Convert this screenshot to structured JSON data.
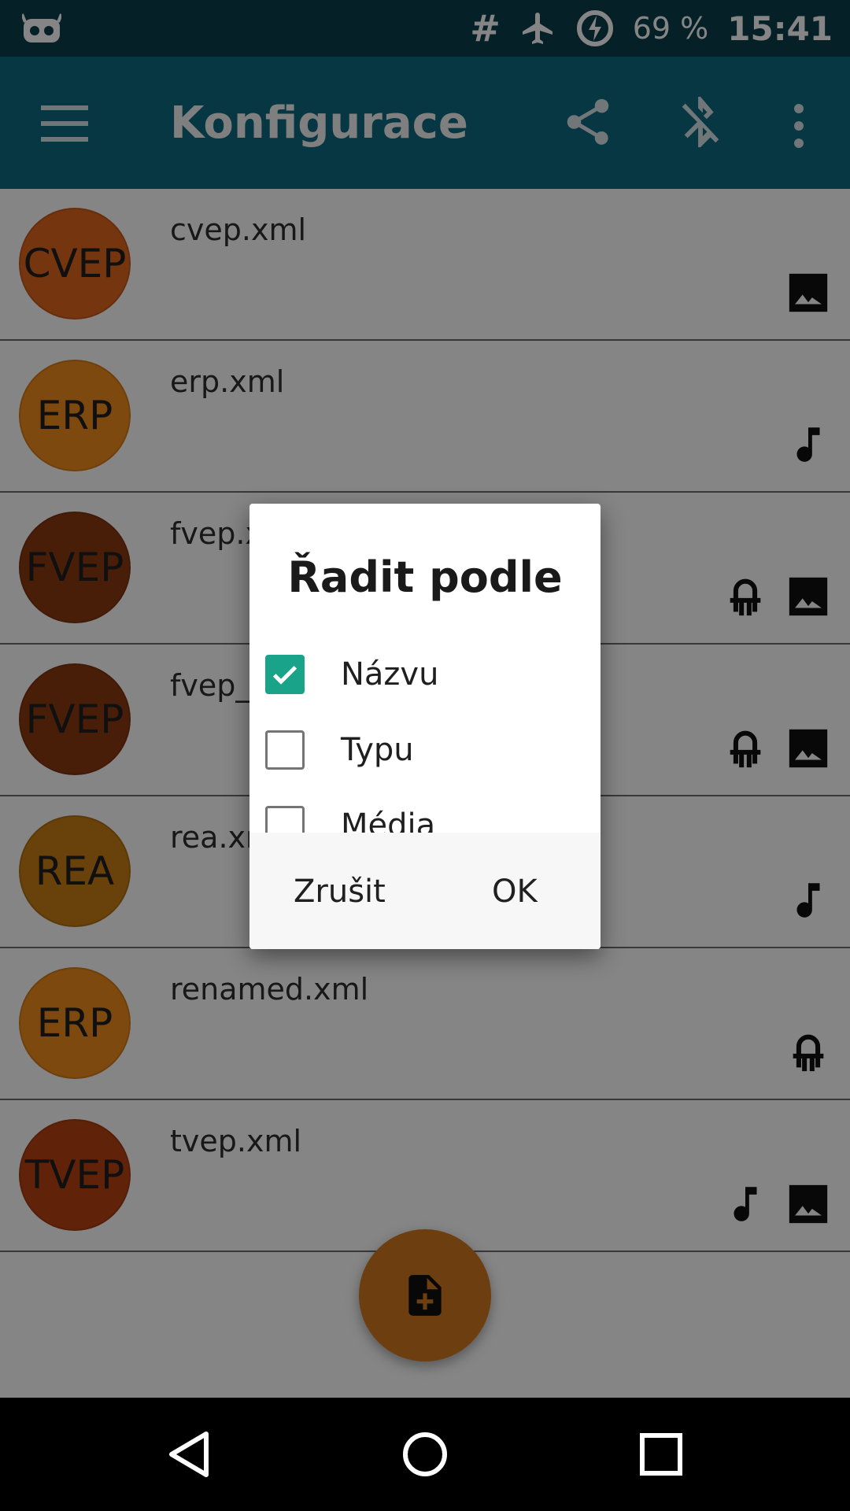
{
  "status": {
    "battery": "69 %",
    "time": "15:41"
  },
  "appbar": {
    "title": "Konfigurace"
  },
  "rows": [
    {
      "abbr": "CVEP",
      "name": "cvep.xml",
      "color": "#e0661d",
      "icons": [
        "image-icon"
      ]
    },
    {
      "abbr": "ERP",
      "name": "erp.xml",
      "color": "#ef8d1c",
      "icons": [
        "music-note-icon"
      ]
    },
    {
      "abbr": "FVEP",
      "name": "fvep.xml",
      "color": "#8d3b12",
      "icons": [
        "led-icon",
        "image-icon"
      ]
    },
    {
      "abbr": "FVEP",
      "name": "fvep_",
      "color": "#8d3b12",
      "icons": [
        "led-icon",
        "image-icon"
      ]
    },
    {
      "abbr": "REA",
      "name": "rea.xml",
      "color": "#c97e16",
      "icons": [
        "music-note-icon"
      ]
    },
    {
      "abbr": "ERP",
      "name": "renamed.xml",
      "color": "#ef8d1c",
      "icons": [
        "led-icon"
      ]
    },
    {
      "abbr": "TVEP",
      "name": "tvep.xml",
      "color": "#ba4214",
      "icons": [
        "music-note-icon",
        "image-icon"
      ]
    }
  ],
  "dialog": {
    "title": "Řadit podle",
    "options": [
      {
        "label": "Názvu",
        "checked": true
      },
      {
        "label": "Typu",
        "checked": false
      },
      {
        "label": "Média",
        "checked": false
      }
    ],
    "cancel": "Zrušit",
    "ok": "OK"
  },
  "colors": {
    "statusbar": "#0a3f4c",
    "appbar": "#0f6a80",
    "accent": "#19a48a",
    "fab": "#d2771d"
  }
}
